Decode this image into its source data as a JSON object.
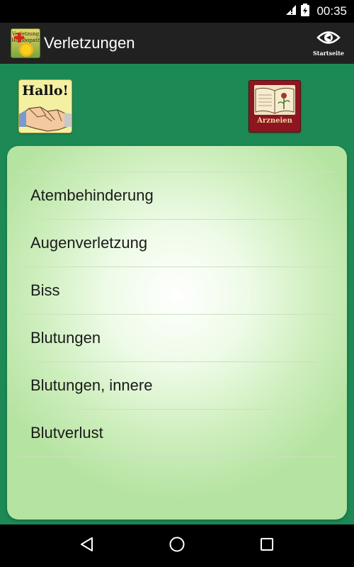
{
  "status": {
    "time": "00:35",
    "icons": [
      "signal-icon",
      "battery-icon"
    ]
  },
  "actionbar": {
    "title": "Verletzungen",
    "app_icon_text": [
      "Verletzung",
      "Homöopathie"
    ],
    "home_label": "Startseite"
  },
  "buttons": {
    "hallo_label": "Hallo!",
    "arzneien_label": "Arzneien"
  },
  "list": {
    "items": [
      "Atembehinderung",
      "Augenverletzung",
      "Biss",
      "Blutungen",
      "Blutungen, innere",
      "Blutverlust"
    ]
  },
  "colors": {
    "content_bg": "#1d8a55",
    "actionbar_bg": "#212121",
    "panel_light": "#ffffff",
    "panel_edge": "#b5e3a1"
  },
  "navbar": {
    "icons": [
      "back-icon",
      "home-icon",
      "recents-icon"
    ]
  }
}
